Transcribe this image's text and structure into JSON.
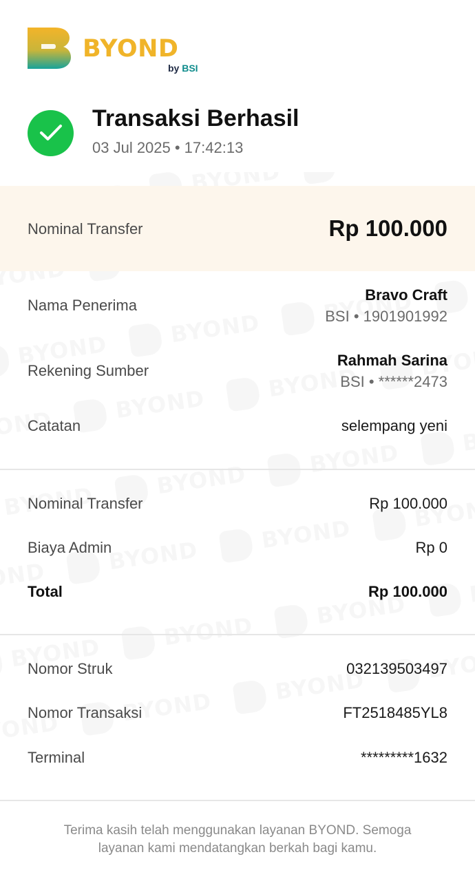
{
  "brand": {
    "name": "BYOND",
    "by_prefix": "by",
    "by_name": "BSI",
    "colors": {
      "gold": "#f0b429",
      "teal": "#0f8c8c",
      "success": "#19c24a",
      "band": "#fdf6ec"
    }
  },
  "status": {
    "icon": "check-circle-icon",
    "title": "Transaksi Berhasil",
    "datetime": "03 Jul 2025 • 17:42:13"
  },
  "highlight": {
    "label": "Nominal Transfer",
    "value": "Rp 100.000"
  },
  "details": {
    "recipient": {
      "label": "Nama Penerima",
      "name": "Bravo Craft",
      "account": "BSI • 1901901992"
    },
    "source": {
      "label": "Rekening Sumber",
      "name": "Rahmah Sarina",
      "account": "BSI • ******2473"
    },
    "note": {
      "label": "Catatan",
      "value": "selempang yeni"
    }
  },
  "summary": {
    "nominal": {
      "label": "Nominal Transfer",
      "value": "Rp 100.000"
    },
    "admin": {
      "label": "Biaya Admin",
      "value": "Rp 0"
    },
    "total": {
      "label": "Total",
      "value": "Rp 100.000"
    }
  },
  "reference": {
    "receipt": {
      "label": "Nomor Struk",
      "value": "032139503497"
    },
    "transaction": {
      "label": "Nomor Transaksi",
      "value": "FT2518485YL8"
    },
    "terminal": {
      "label": "Terminal",
      "value": "*********1632"
    }
  },
  "footer": {
    "message": "Terima kasih telah menggunakan layanan BYOND. Semoga layanan kami mendatangkan berkah bagi kamu."
  }
}
